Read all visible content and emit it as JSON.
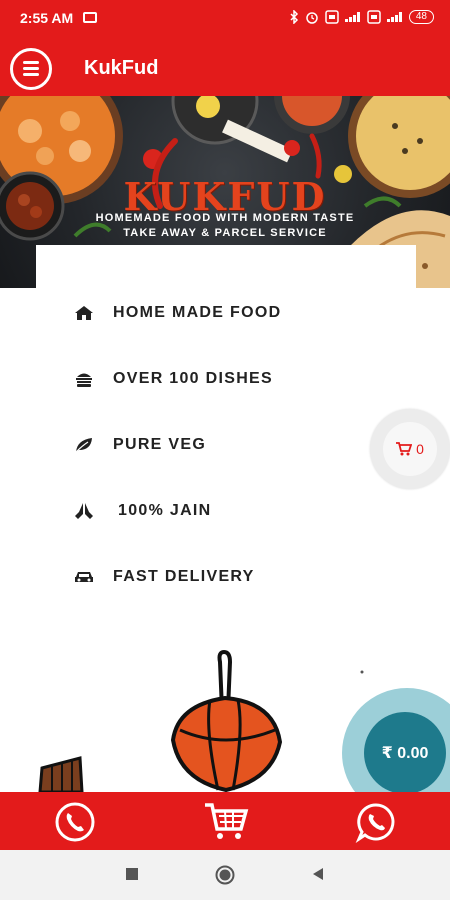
{
  "status_bar": {
    "time": "2:55 AM",
    "battery": "48",
    "icons": [
      "message-icon",
      "bluetooth-icon",
      "alarm-icon",
      "sim-icon",
      "signal-icon",
      "battery-icon"
    ]
  },
  "app_bar": {
    "title": "KukFud",
    "menu_icon": "hamburger-menu-icon"
  },
  "banner": {
    "brand": "KUKFUD",
    "tagline_1": "HOMEMADE FOOD WITH MODERN TASTE",
    "tagline_2": "TAKE AWAY & PARCEL SERVICE"
  },
  "features": [
    {
      "icon": "home-icon",
      "label": "HOME MADE FOOD"
    },
    {
      "icon": "burger-icon",
      "label": "OVER 100 DISHES"
    },
    {
      "icon": "leaf-icon",
      "label": "PURE VEG"
    },
    {
      "icon": "praying-hands-icon",
      "label": "100% JAIN"
    },
    {
      "icon": "car-icon",
      "label": "FAST DELIVERY"
    }
  ],
  "cart_fab": {
    "count": "0",
    "icon": "cart-icon"
  },
  "total_fab": {
    "amount": "₹ 0.00"
  },
  "bottom_bar": {
    "icons": [
      "phone-icon",
      "cart-icon",
      "whatsapp-icon"
    ]
  },
  "nav_bar": {
    "icons": [
      "recents-icon",
      "home-icon",
      "back-icon"
    ]
  },
  "colors": {
    "primary": "#e31b1b",
    "brand_text": "#e4431d",
    "total_fab": "#1e7a8c",
    "total_fab_ring": "#9ccfd8"
  }
}
